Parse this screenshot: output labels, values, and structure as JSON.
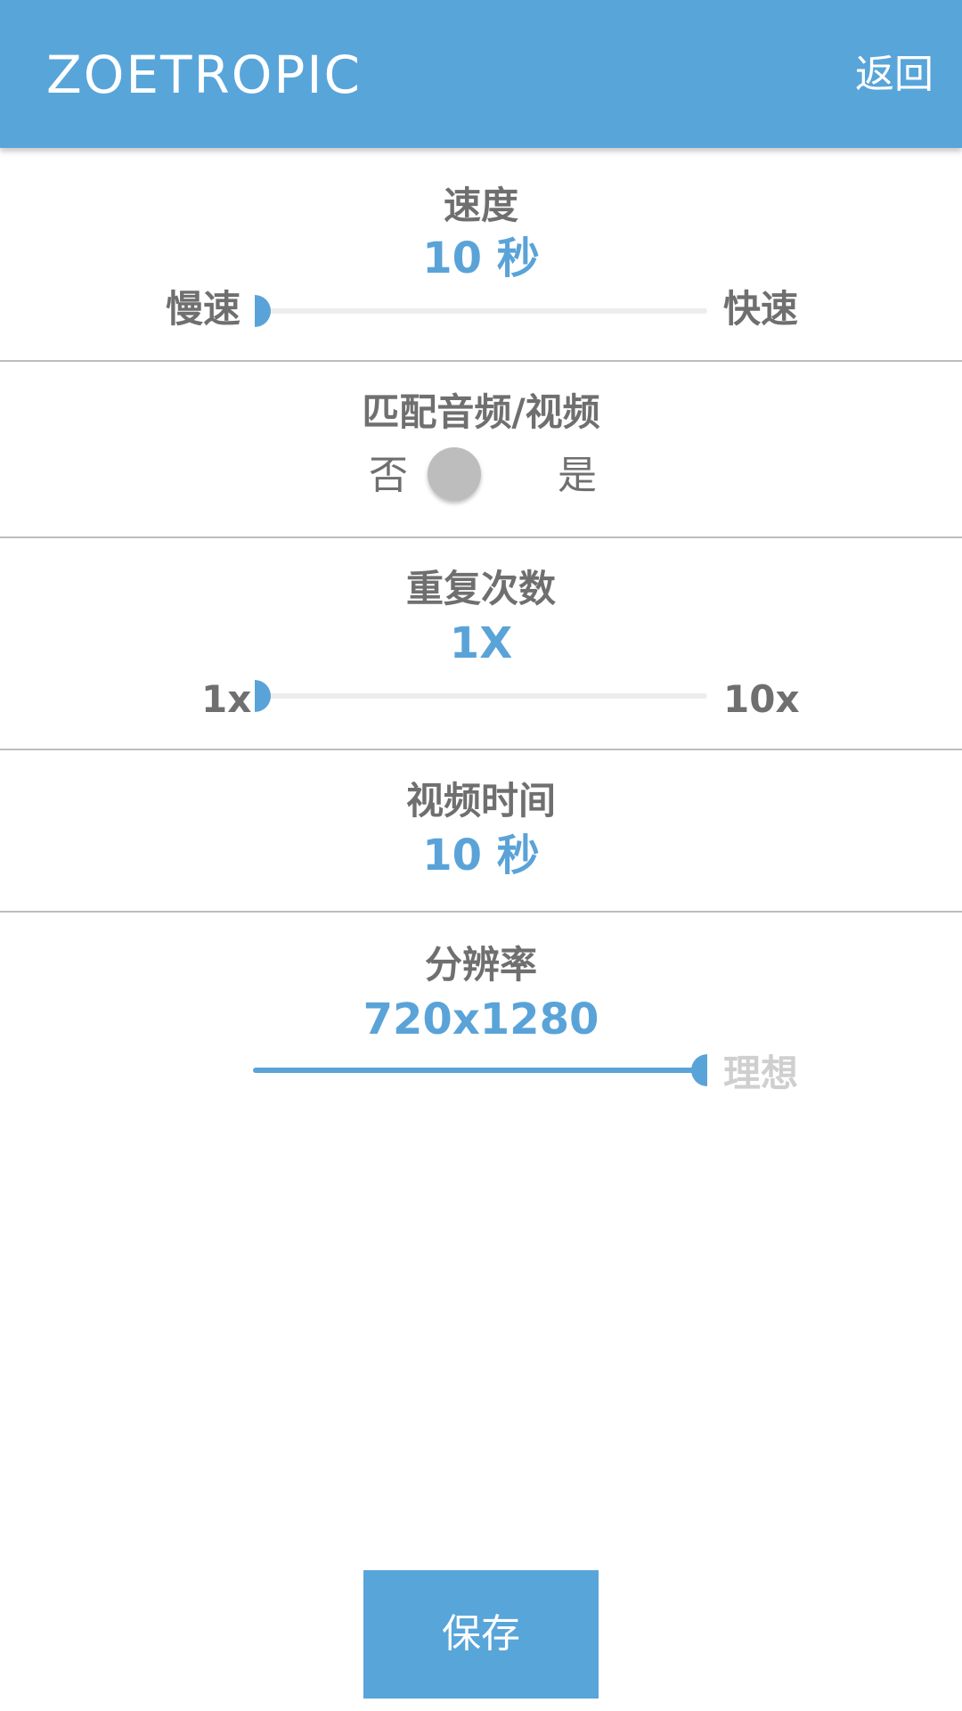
{
  "header": {
    "title": "ZOETROPIC",
    "back_label": "返回"
  },
  "speed": {
    "title": "速度",
    "value": "10 秒",
    "min_label": "慢速",
    "max_label": "快速",
    "slider_fraction": 0.0
  },
  "match_av": {
    "title": "匹配音频/视频",
    "off_label": "否",
    "on_label": "是",
    "enabled": false
  },
  "repeat": {
    "title": "重复次数",
    "value": "1X",
    "min_label": "1x",
    "max_label": "10x",
    "slider_fraction": 0.0
  },
  "video_time": {
    "title": "视频时间",
    "value": "10 秒"
  },
  "resolution": {
    "title": "分辨率",
    "value": "720x1280",
    "max_label": "理想",
    "slider_fraction": 1.0
  },
  "footer": {
    "save_label": "保存"
  },
  "colors": {
    "accent": "#58a5da",
    "value_text": "#5aa3d8",
    "label_text": "#6f6f6f",
    "muted_text": "#cfcfcf"
  }
}
